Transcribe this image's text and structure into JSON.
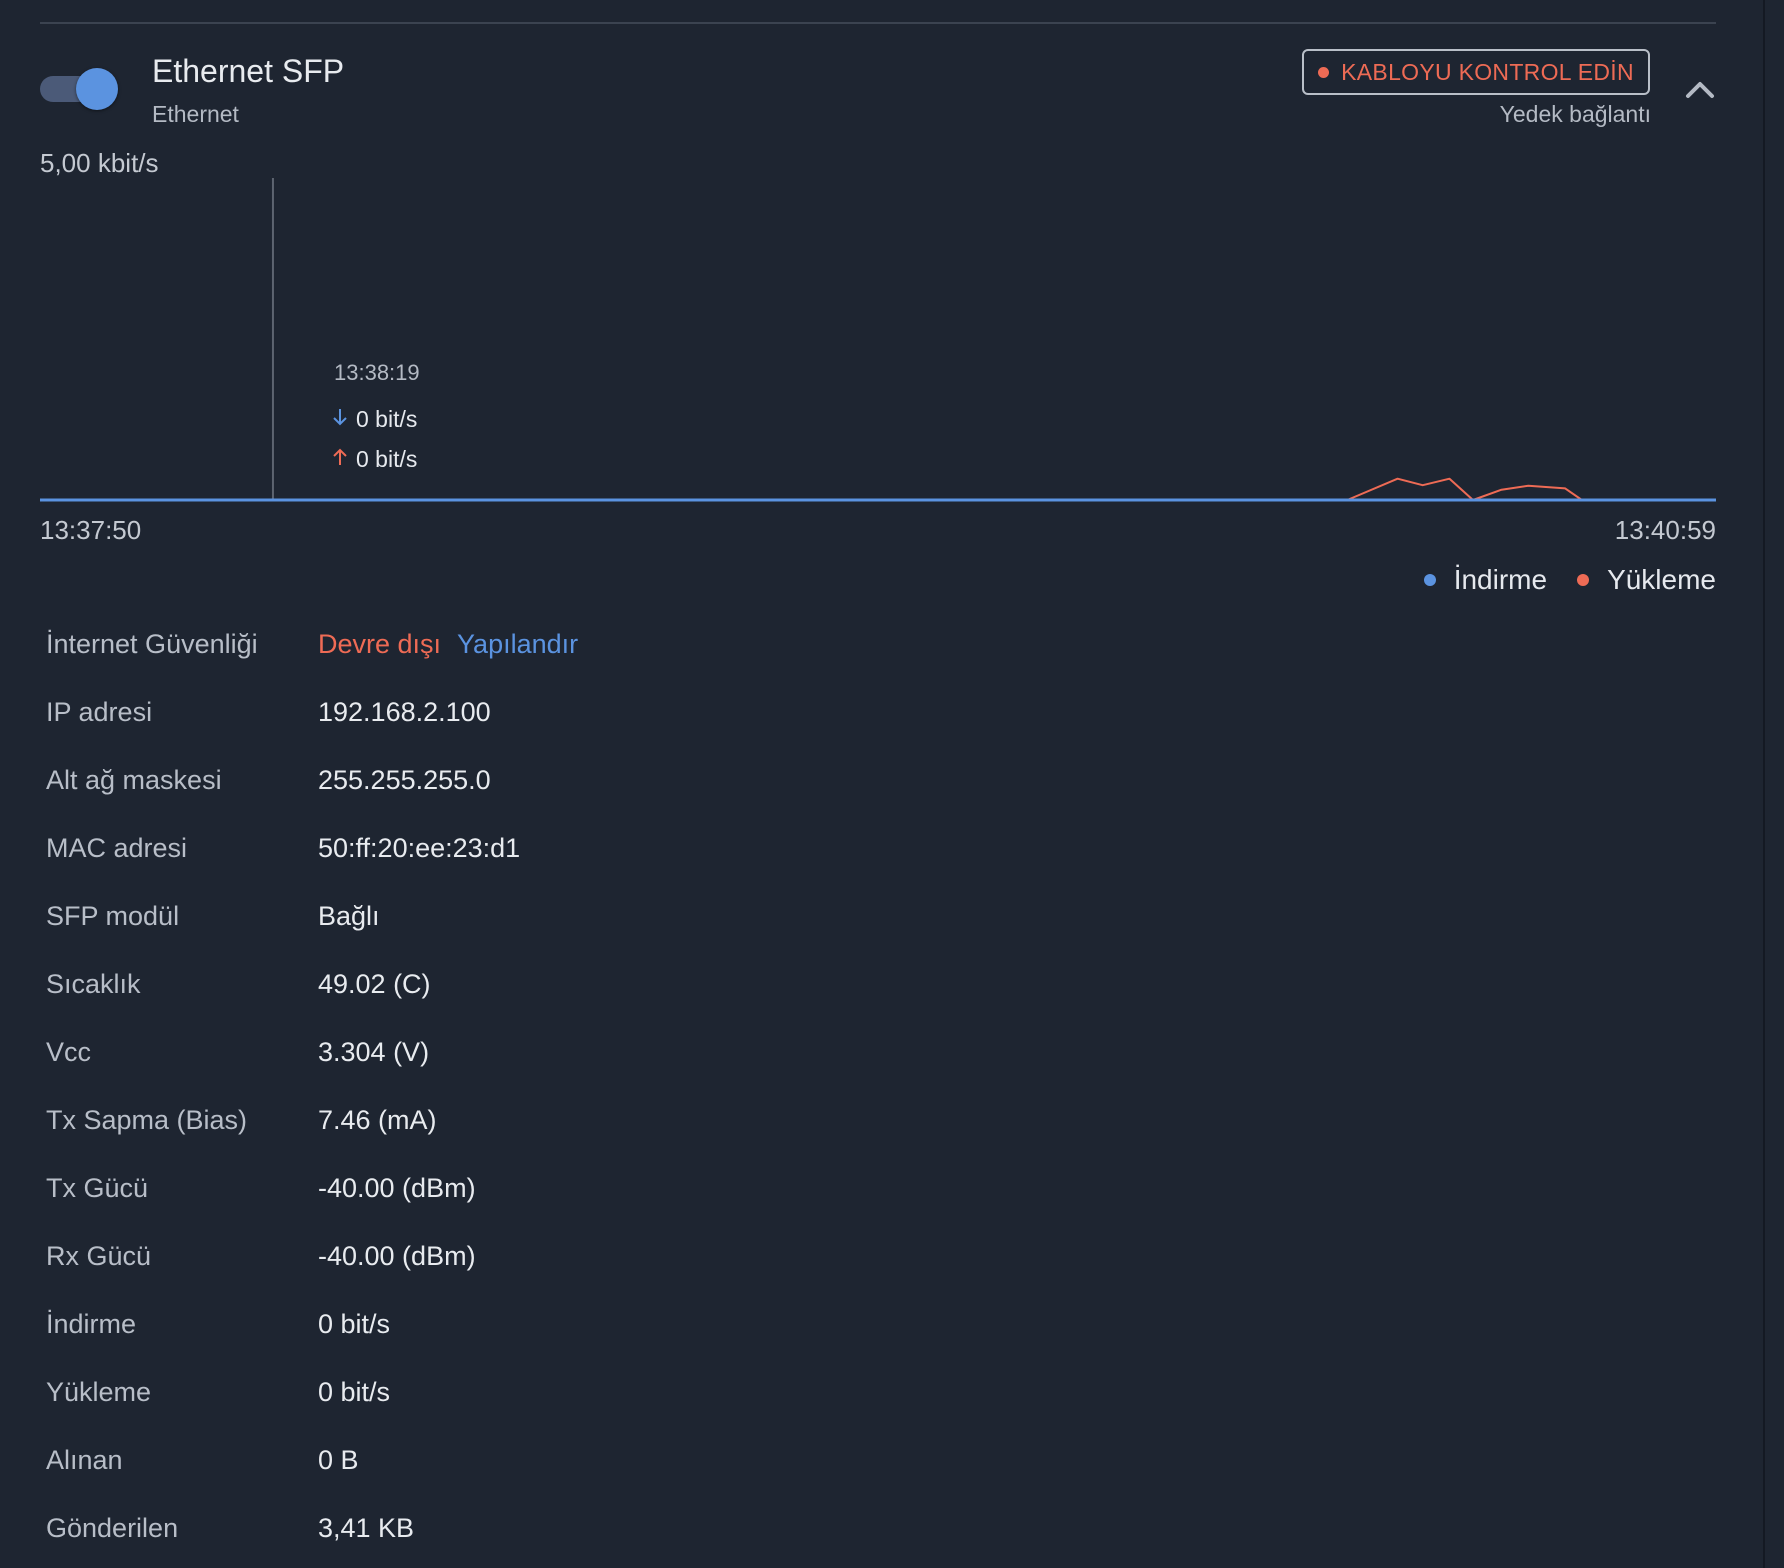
{
  "header": {
    "title": "Ethernet SFP",
    "subtitle": "Ethernet",
    "toggle_on": true,
    "status_badge": "KABLOYU KONTROL EDİN",
    "status_note": "Yedek bağlantı"
  },
  "colors": {
    "background": "#1e2531",
    "download": "#5b93e0",
    "upload": "#ee6b55",
    "label": "#b8bec8",
    "value": "#e8ebef"
  },
  "icons": {
    "collapse": "chevron-up-icon",
    "download": "arrow-down-icon",
    "upload": "arrow-up-icon"
  },
  "chart_data": {
    "type": "line",
    "y_max_label": "5,00 kbit/s",
    "x_start_label": "13:37:50",
    "x_end_label": "13:40:59",
    "ylim": [
      0,
      5000
    ],
    "series": [
      {
        "name": "İndirme",
        "color": "#5b93e0",
        "x": [
          0,
          1
        ],
        "values": [
          0,
          0
        ]
      },
      {
        "name": "Yükleme",
        "color": "#ee6b55",
        "x": [
          0,
          0.78,
          0.81,
          0.825,
          0.841,
          0.855,
          0.872,
          0.888,
          0.91,
          0.92,
          0.928
        ],
        "values": [
          0,
          0,
          330,
          230,
          330,
          0,
          160,
          220,
          180,
          0,
          0
        ]
      }
    ],
    "hover": {
      "x": 0.139,
      "time": "13:38:19",
      "download": "0 bit/s",
      "upload": "0 bit/s"
    },
    "legend": [
      "İndirme",
      "Yükleme"
    ],
    "legend_position": "bottom-right",
    "grid": false
  },
  "details": {
    "security_label": "İnternet Güvenliği",
    "security_status": "Devre dışı",
    "security_action": "Yapılandır",
    "rows": [
      {
        "label": "IP adresi",
        "value": "192.168.2.100"
      },
      {
        "label": "Alt ağ maskesi",
        "value": "255.255.255.0"
      },
      {
        "label": "MAC adresi",
        "value": "50:ff:20:ee:23:d1"
      },
      {
        "label": "SFP modül",
        "value": "Bağlı"
      },
      {
        "label": "Sıcaklık",
        "value": "49.02 (C)"
      },
      {
        "label": "Vcc",
        "value": "3.304 (V)"
      },
      {
        "label": "Tx Sapma (Bias)",
        "value": "7.46 (mA)"
      },
      {
        "label": "Tx Gücü",
        "value": "-40.00 (dBm)"
      },
      {
        "label": "Rx Gücü",
        "value": "-40.00 (dBm)"
      },
      {
        "label": "İndirme",
        "value": "0 bit/s"
      },
      {
        "label": "Yükleme",
        "value": "0 bit/s"
      },
      {
        "label": "Alınan",
        "value": "0 B"
      },
      {
        "label": "Gönderilen",
        "value": "3,41 KB"
      }
    ]
  }
}
